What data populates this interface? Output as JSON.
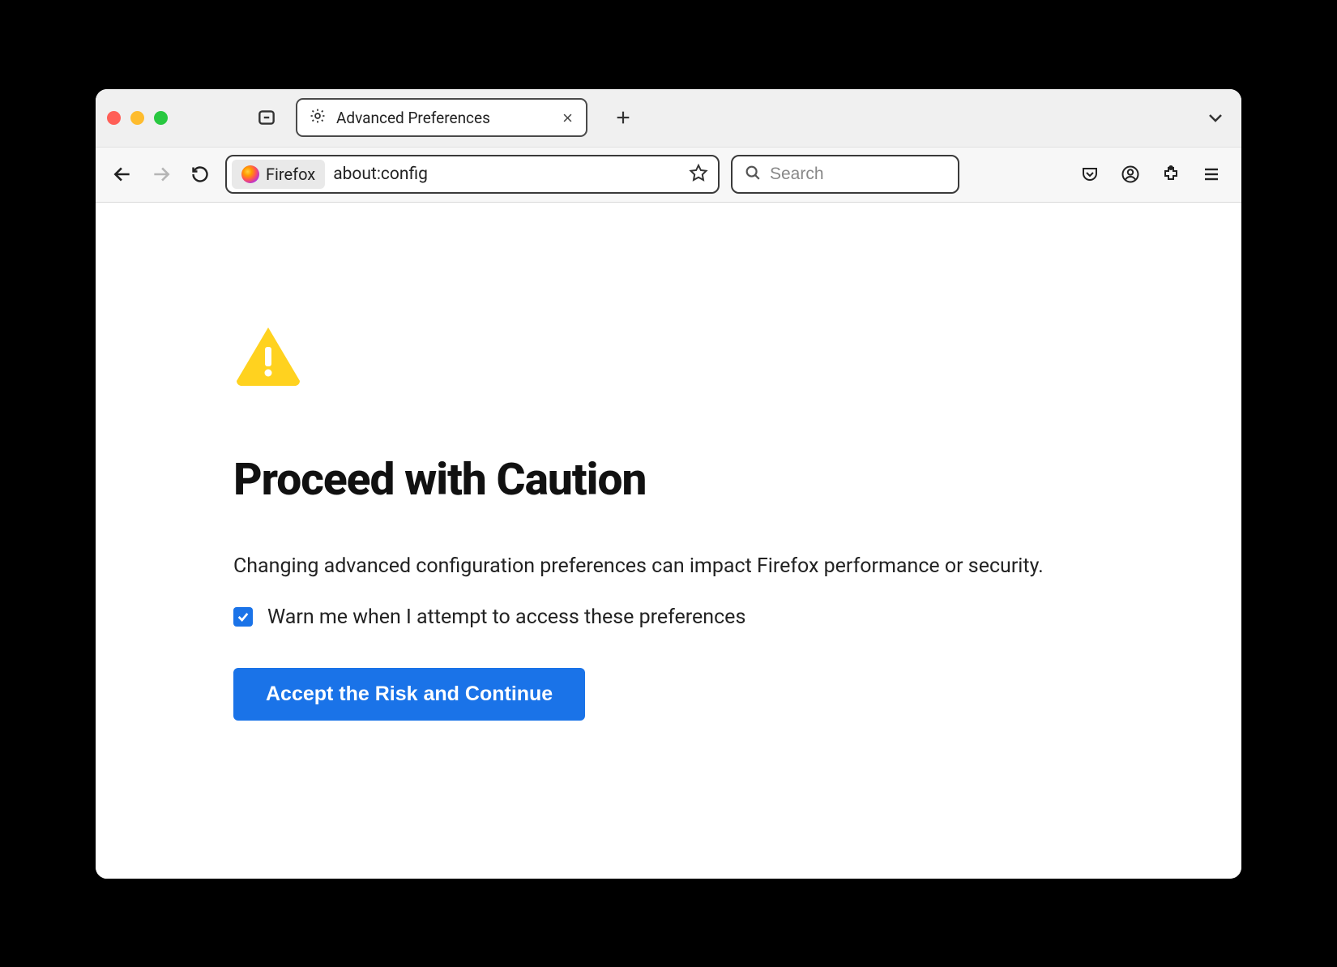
{
  "tab": {
    "title": "Advanced Preferences"
  },
  "urlbar": {
    "identity_label": "Firefox",
    "url": "about:config"
  },
  "searchbar": {
    "placeholder": "Search"
  },
  "page": {
    "heading": "Proceed with Caution",
    "body": "Changing advanced configuration preferences can impact Firefox performance or security.",
    "checkbox_label": "Warn me when I attempt to access these preferences",
    "checkbox_checked": true,
    "accept_button": "Accept the Risk and Continue"
  }
}
